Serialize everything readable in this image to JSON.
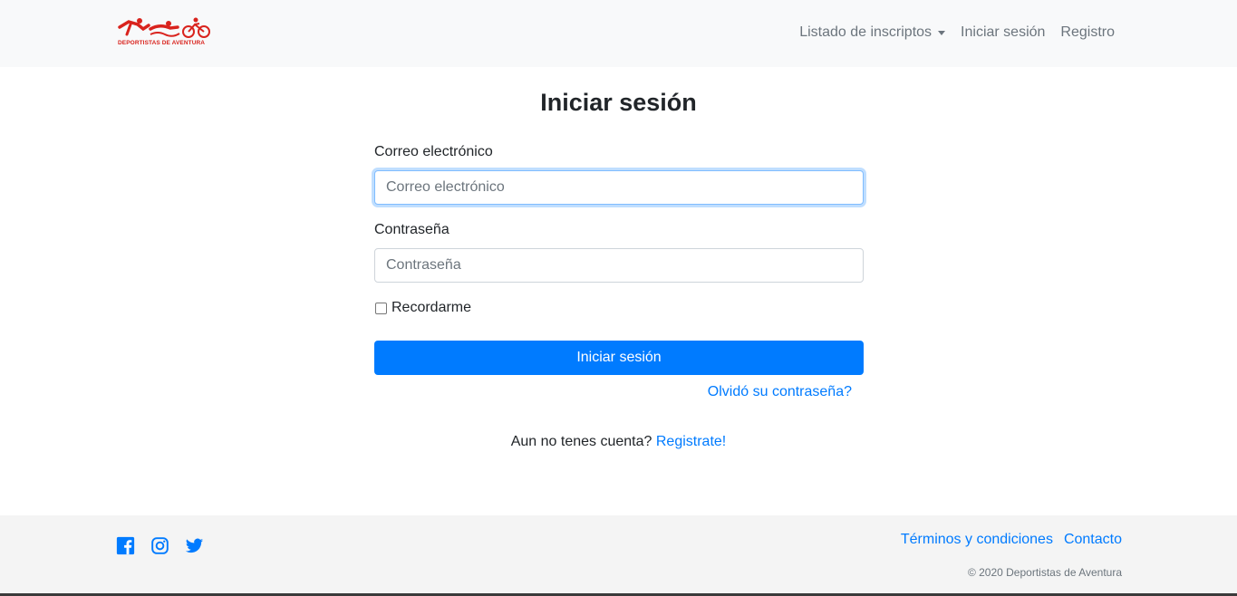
{
  "brand": {
    "logo_text": "DEPORTISTAS DE AVENTURA",
    "color": "#d9231d"
  },
  "nav": {
    "items": [
      {
        "label": "Listado de inscriptos",
        "dropdown": true
      },
      {
        "label": "Iniciar sesión"
      },
      {
        "label": "Registro"
      }
    ]
  },
  "form": {
    "title": "Iniciar sesión",
    "email_label": "Correo electrónico",
    "email_placeholder": "Correo electrónico",
    "email_value": "",
    "password_label": "Contraseña",
    "password_placeholder": "Contraseña",
    "password_value": "",
    "remember_label": "Recordarme",
    "remember_checked": false,
    "submit_label": "Iniciar sesión",
    "forgot_label": "Olvidó su contraseña?",
    "register_prompt": "Aun no tenes cuenta?",
    "register_link": "Registrate!"
  },
  "footer": {
    "social": [
      "facebook-icon",
      "instagram-icon",
      "twitter-icon"
    ],
    "links": [
      "Términos y condiciones",
      "Contacto"
    ],
    "copyright": "© 2020 Deportistas de Aventura"
  },
  "colors": {
    "primary": "#007bff",
    "navbar_bg": "#f8f9fa",
    "footer_bg": "#f4f4f4",
    "muted": "#6c757d"
  }
}
